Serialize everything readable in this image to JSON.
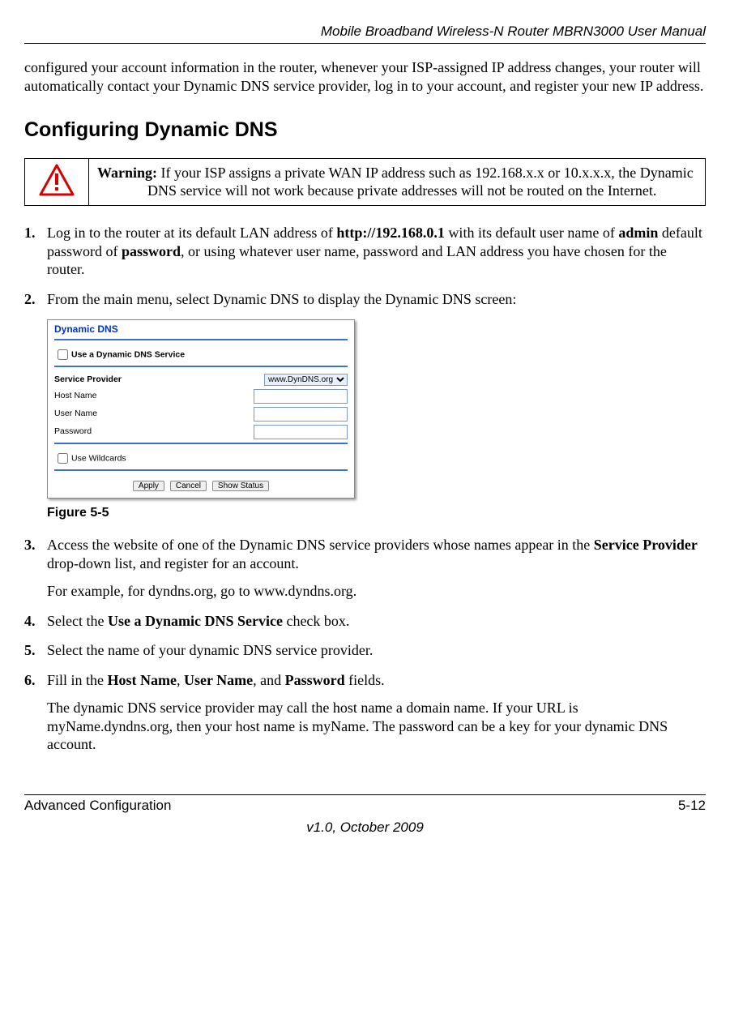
{
  "header": {
    "title": "Mobile Broadband Wireless-N Router MBRN3000 User Manual"
  },
  "intro": "configured your account information in the router, whenever your ISP-assigned IP address changes, your router will automatically contact your Dynamic DNS service provider, log in to your account, and register your new IP address.",
  "section_heading": "Configuring Dynamic DNS",
  "warning": {
    "label": "Warning:",
    "text": "If your ISP assigns a private WAN IP address such as 192.168.x.x or 10.x.x.x, the Dynamic DNS service will not work because private addresses will not be routed on the Internet."
  },
  "steps": {
    "s1_a": "Log in to the router at its default LAN address of ",
    "s1_b_bold": "http://192.168.0.1",
    "s1_c": " with its default user name of ",
    "s1_d_bold": "admin",
    "s1_e": " default password of ",
    "s1_f_bold": "password",
    "s1_g": ", or using whatever user name, password and LAN address you have chosen for the router.",
    "s2": "From the main menu, select Dynamic DNS to display the Dynamic DNS screen:",
    "s3_a": "Access the website of one of the Dynamic DNS service providers whose names appear in the ",
    "s3_b_bold": "Service Provider",
    "s3_c": " drop-down list, and register for an account.",
    "s3_sub": "For example, for dyndns.org, go to www.dyndns.org.",
    "s4_a": "Select the ",
    "s4_b_bold": "Use a Dynamic DNS Service",
    "s4_c": " check box.",
    "s5": "Select the name of your dynamic DNS service provider.",
    "s6_a": "Fill in the ",
    "s6_b_bold": "Host Name",
    "s6_c": ", ",
    "s6_d_bold": "User Name",
    "s6_e": ", and ",
    "s6_f_bold": "Password",
    "s6_g": " fields.",
    "s6_sub": "The dynamic DNS service provider may call the host name a domain name. If your URL is myName.dyndns.org, then your host name is myName. The password can be a key for your dynamic DNS account."
  },
  "nums": {
    "n1": "1.",
    "n2": "2.",
    "n3": "3.",
    "n4": "4.",
    "n5": "5.",
    "n6": "6."
  },
  "ui": {
    "title": "Dynamic DNS",
    "use_service": "Use a Dynamic DNS Service",
    "service_provider_label": "Service Provider",
    "service_provider_value": "www.DynDNS.org",
    "host_name_label": "Host Name",
    "user_name_label": "User Name",
    "password_label": "Password",
    "use_wildcards": "Use Wildcards",
    "btn_apply": "Apply",
    "btn_cancel": "Cancel",
    "btn_status": "Show Status"
  },
  "figure_caption": "Figure 5-5",
  "footer": {
    "left": "Advanced Configuration",
    "right": "5-12",
    "center": "v1.0, October 2009"
  }
}
